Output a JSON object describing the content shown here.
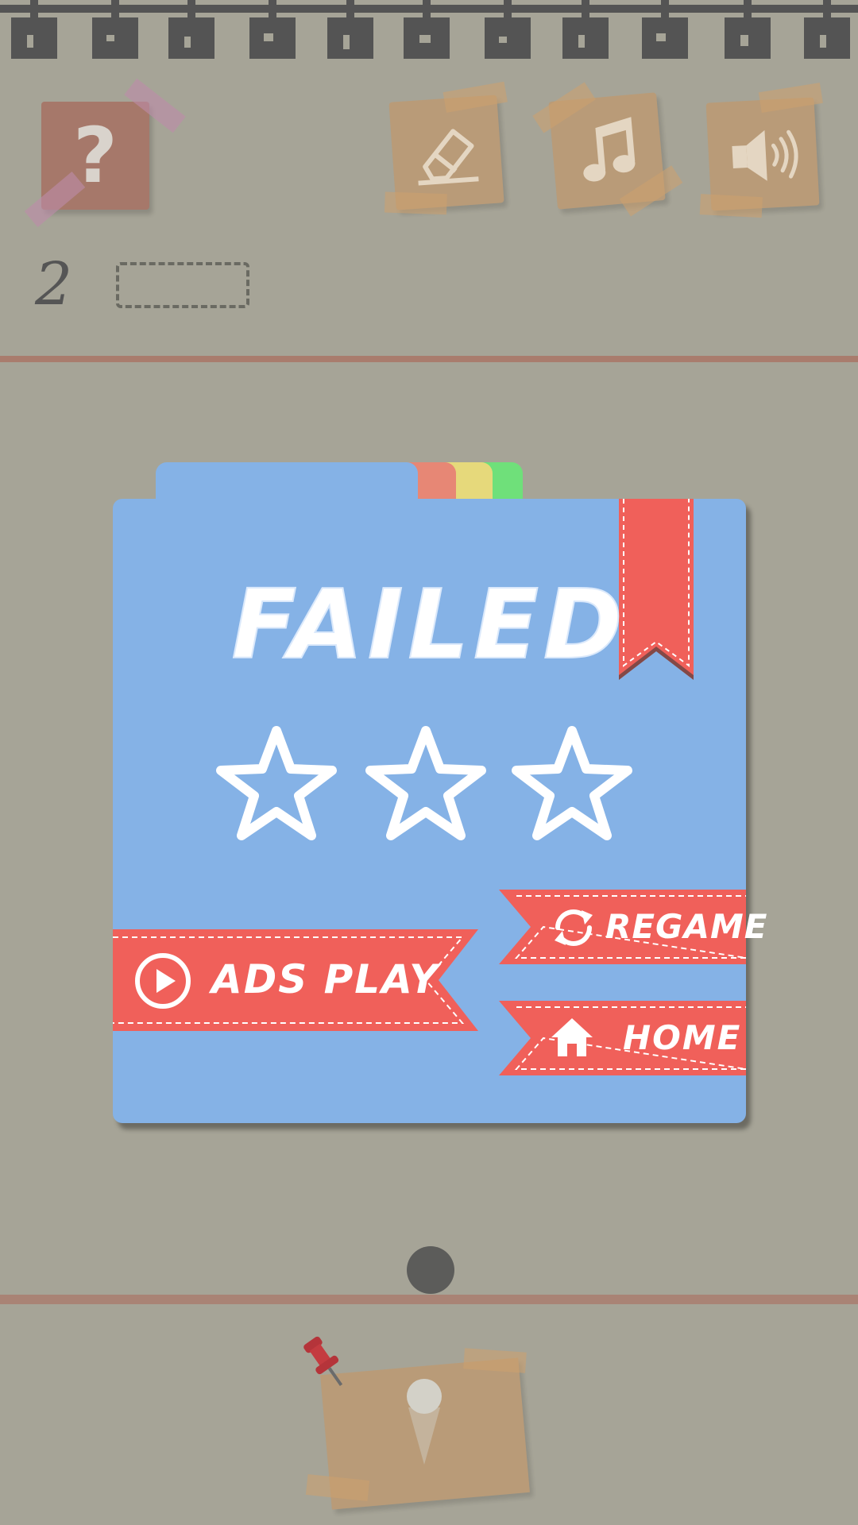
{
  "top_bar": {
    "help_icon": "question-mark-icon",
    "eraser_icon": "eraser-icon",
    "music_icon": "music-note-icon",
    "sound_icon": "speaker-icon",
    "help_glyph": "?"
  },
  "level": {
    "number": "2"
  },
  "dialog": {
    "title": "FAILED",
    "stars_earned": 0,
    "stars_total": 3,
    "buttons": {
      "ads_play": "ADS PLAY",
      "regame": "REGAME",
      "home": "HOME"
    }
  },
  "colors": {
    "background": "#a6a497",
    "dialog_blue": "#85b2e6",
    "ribbon_red": "#f0605a",
    "tab_green": "#6fe07a",
    "tab_yellow": "#e6d97b",
    "tab_red": "#e78775"
  }
}
